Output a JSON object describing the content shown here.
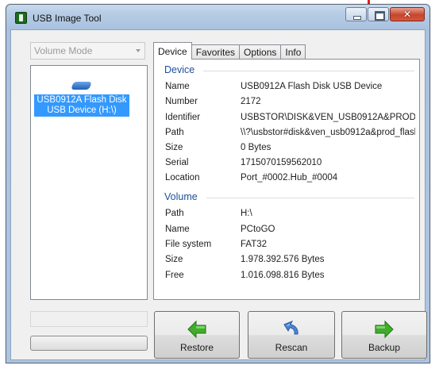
{
  "window": {
    "title": "USB Image Tool"
  },
  "mode_select": {
    "value": "Volume Mode"
  },
  "device_list": {
    "items": [
      {
        "label_line1": "USB0912A Flash Disk",
        "label_line2": "USB Device (H:\\)"
      }
    ]
  },
  "tabs": [
    "Device",
    "Favorites",
    "Options",
    "Info"
  ],
  "active_tab": "Device",
  "device": {
    "header": "Device",
    "rows": [
      {
        "key": "Name",
        "value": "USB0912A Flash Disk USB Device"
      },
      {
        "key": "Number",
        "value": "2172"
      },
      {
        "key": "Identifier",
        "value": "USBSTOR\\DISK&VEN_USB0912A&PROD_"
      },
      {
        "key": "Path",
        "value": "\\\\?\\usbstor#disk&ven_usb0912a&prod_flash"
      },
      {
        "key": "Size",
        "value": "0 Bytes"
      },
      {
        "key": "Serial",
        "value": "1715070159562010"
      },
      {
        "key": "Location",
        "value": "Port_#0002.Hub_#0004"
      }
    ]
  },
  "volume": {
    "header": "Volume",
    "rows": [
      {
        "key": "Path",
        "value": "H:\\"
      },
      {
        "key": "Name",
        "value": "PCtoGO"
      },
      {
        "key": "File system",
        "value": "FAT32"
      },
      {
        "key": "Size",
        "value": "1.978.392.576 Bytes"
      },
      {
        "key": "Free",
        "value": "1.016.098.816 Bytes"
      }
    ]
  },
  "buttons": {
    "restore": "Restore",
    "rescan": "Rescan",
    "backup": "Backup"
  },
  "icons": {
    "app": "usb-image-tool-icon",
    "restore": "green-left-arrow-icon",
    "rescan": "blue-refresh-arrow-icon",
    "backup": "green-right-arrow-icon"
  },
  "colors": {
    "selection": "#3399ff",
    "group_header": "#1e4f9c",
    "arrow_green": "#3fae2a"
  }
}
